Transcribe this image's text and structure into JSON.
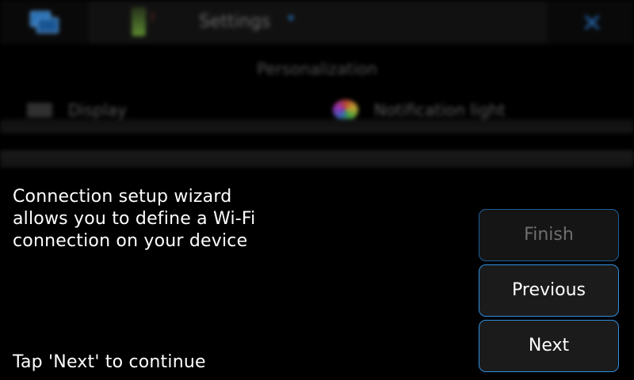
{
  "background_app": {
    "title": "Settings",
    "section_heading": "Personalization",
    "items": [
      {
        "label": "Display",
        "icon": "display-icon"
      },
      {
        "label": "Notification light",
        "icon": "notification-light-icon"
      }
    ],
    "icons": {
      "task_switcher": "task-switcher-icon",
      "battery": "battery-icon",
      "signal": "signal-icon",
      "title_menu": "dropdown-arrow-icon",
      "close": "close-icon"
    }
  },
  "wizard": {
    "message": "Connection setup wizard allows you to define a Wi-Fi connection on your device",
    "hint": "Tap 'Next' to continue",
    "buttons": {
      "finish": {
        "label": "Finish",
        "enabled": false
      },
      "previous": {
        "label": "Previous",
        "enabled": true
      },
      "next": {
        "label": "Next",
        "enabled": true
      }
    }
  },
  "colors": {
    "accent": "#2f8fe0",
    "background": "#000000",
    "button_fill": "#1b1b1b",
    "text": "#ffffff",
    "disabled_text": "#6f6f6f"
  }
}
